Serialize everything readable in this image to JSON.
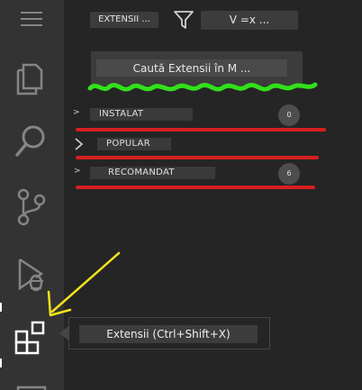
{
  "activity_bar": {
    "items": [
      {
        "icon": "menu-icon"
      },
      {
        "icon": "files-icon"
      },
      {
        "icon": "search-icon"
      },
      {
        "icon": "source-control-icon"
      },
      {
        "icon": "run-debug-icon"
      },
      {
        "icon": "extensions-icon",
        "active": true
      },
      {
        "icon": "remote-explorer-icon"
      }
    ]
  },
  "header": {
    "title": "EXTENSII ...",
    "filter_icon": "filter-icon",
    "views_label": "V =x ..."
  },
  "search": {
    "placeholder": "Caută Extensii în M ..."
  },
  "sections": [
    {
      "label": "INSTALAT",
      "badge": "0"
    },
    {
      "label": "POPULAR"
    },
    {
      "label": "RECOMANDAT",
      "badge": "6"
    }
  ],
  "tooltip": {
    "text": "Extensii (Ctrl+Shift+X)"
  },
  "annotations": {
    "search_underline_color": "#32e01a",
    "section_underline_color": "#d61f1f",
    "arrow_color": "#f2e21b"
  }
}
